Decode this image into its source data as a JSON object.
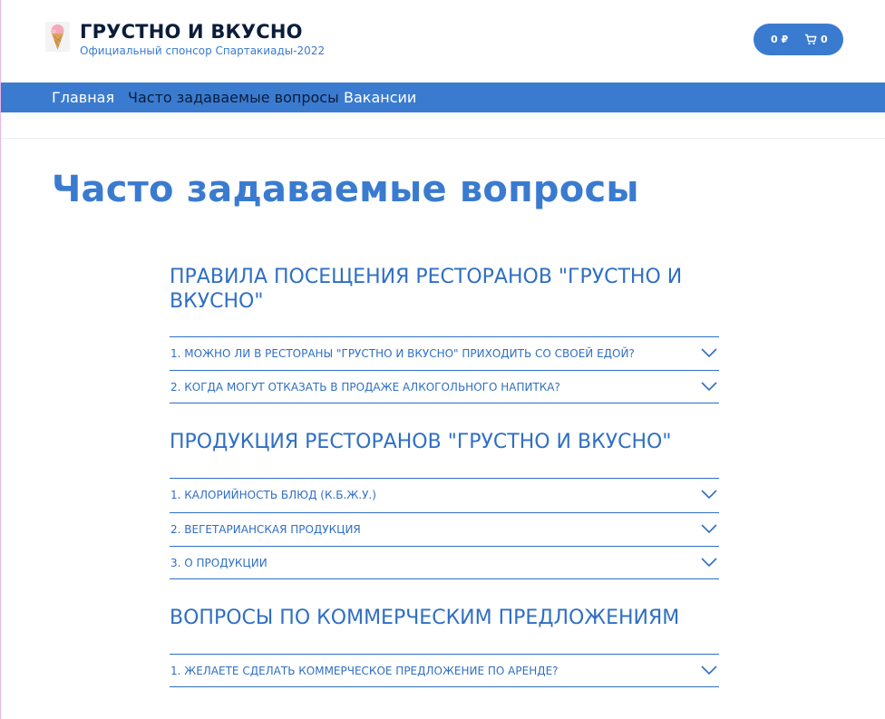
{
  "brand": {
    "title": "ГРУСТНО И ВКУСНО",
    "subtitle": "Официальный спонсор Спартакиады-2022",
    "logo_icon": "ice-cream-icon"
  },
  "cart": {
    "total": "0 ₽",
    "count": "0",
    "icon": "cart-icon"
  },
  "nav": {
    "items": [
      {
        "label": "Главная",
        "active": false
      },
      {
        "label": "Часто задаваемые вопросы",
        "active": true
      },
      {
        "label": "Вакансии",
        "active": false
      }
    ]
  },
  "page": {
    "title": "Часто задаваемые вопросы"
  },
  "sections": [
    {
      "title": "ПРАВИЛА ПОСЕЩЕНИЯ РЕСТОРАНОВ \"ГРУСТНО И ВКУСНО\"",
      "questions": [
        "1. МОЖНО ЛИ В РЕСТОРАНЫ \"ГРУСТНО И ВКУСНО\" ПРИХОДИТЬ СО СВОЕЙ ЕДОЙ?",
        "2. КОГДА МОГУТ ОТКАЗАТЬ В ПРОДАЖЕ АЛКОГОЛЬНОГО НАПИТКА?"
      ]
    },
    {
      "title": "ПРОДУКЦИЯ РЕСТОРАНОВ \"ГРУСТНО И ВКУСНО\"",
      "questions": [
        "1. КАЛОРИЙНОСТЬ БЛЮД (К.Б.Ж.У.)",
        "2. ВЕГЕТАРИАНСКАЯ ПРОДУКЦИЯ",
        "3. О ПРОДУКЦИИ"
      ]
    },
    {
      "title": "ВОПРОСЫ ПО КОММЕРЧЕСКИМ ПРЕДЛОЖЕНИЯМ",
      "questions": [
        "1. ЖЕЛАЕТЕ СДЕЛАТЬ КОММЕРЧЕСКОЕ ПРЕДЛОЖЕНИЕ ПО АРЕНДЕ?"
      ]
    }
  ],
  "colors": {
    "accent": "#3a7bd0",
    "dark": "#0b1d3a",
    "white": "#ffffff"
  }
}
